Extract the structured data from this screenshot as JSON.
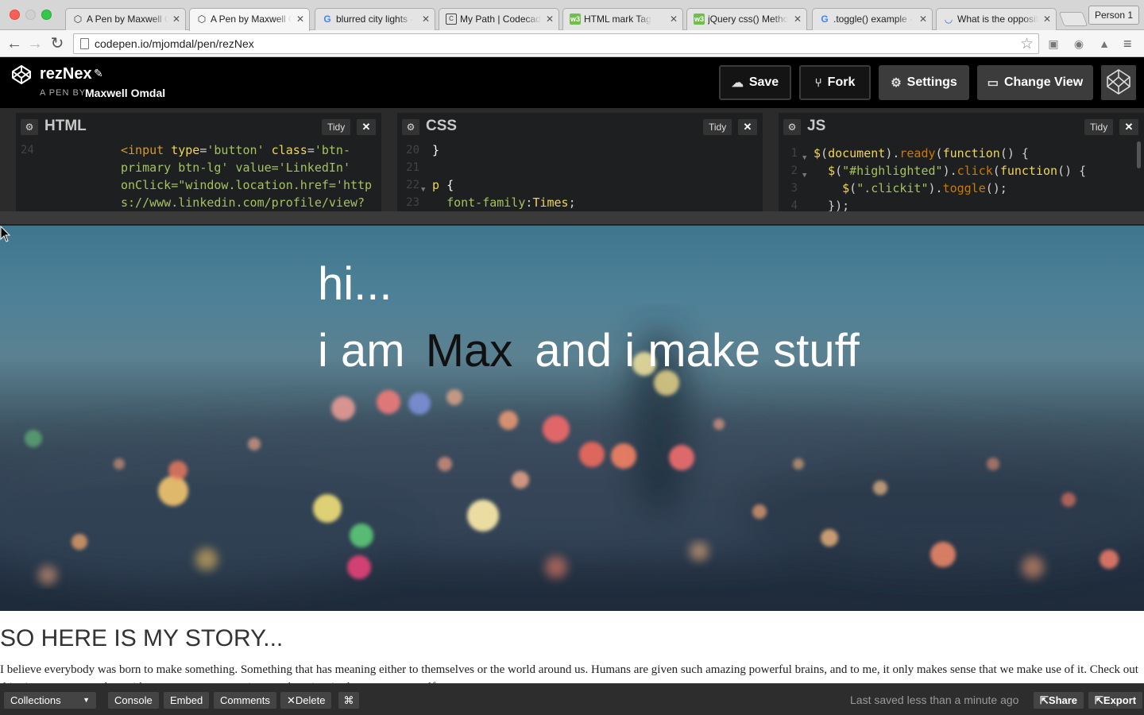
{
  "browser": {
    "tabs": [
      {
        "label": "A Pen by Maxwell O",
        "icon": "codepen-icon"
      },
      {
        "label": "A Pen by Maxwell O",
        "icon": "codepen-icon",
        "active": true
      },
      {
        "label": "blurred city lights -",
        "icon": "google-icon"
      },
      {
        "label": "My Path | Codecade",
        "icon": "codecademy-icon"
      },
      {
        "label": "HTML mark Tag",
        "icon": "w3schools-icon"
      },
      {
        "label": "jQuery css() Metho",
        "icon": "w3schools-icon"
      },
      {
        "label": ".toggle() example -",
        "icon": "google-icon"
      },
      {
        "label": "What is the opposit",
        "icon": "stackoverflow-icon"
      }
    ],
    "person": "Person 1",
    "url": "codepen.io/mjomdal/pen/rezNex"
  },
  "header": {
    "pen_title": "rezNex",
    "by_prefix": "A PEN BY",
    "author": "Maxwell Omdal",
    "buttons": {
      "save": "Save",
      "fork": "Fork",
      "settings": "Settings",
      "change_view": "Change View"
    }
  },
  "editors": {
    "tidy": "Tidy",
    "html": {
      "title": "HTML",
      "line_numbers": [
        "24"
      ],
      "lines": [
        "<input type='button' class='btn-",
        "primary btn-lg' value='LinkedIn'",
        "onClick=\"window.location.href='http",
        "s://www.linkedin.com/profile/view?"
      ]
    },
    "css": {
      "title": "CSS",
      "line_numbers": [
        "20",
        "21",
        "22",
        "23"
      ],
      "lines": [
        "}",
        "",
        "p {",
        "  font-family:Times;"
      ]
    },
    "js": {
      "title": "JS",
      "line_numbers": [
        "1",
        "2",
        "3",
        "4"
      ],
      "lines": [
        "$(document).ready(function() {",
        "  $(\"#highlighted\").click(function() {",
        "    $(\".clickit\").toggle();",
        "  });"
      ]
    }
  },
  "preview": {
    "greeting": "hi...",
    "tagline_before": "i am",
    "name": "Max",
    "tagline_after": "and i make stuff",
    "story_title": "SO HERE IS MY STORY...",
    "story_text": "I believe everybody was born to make something. Something that has meaning either to themselves or the world around us. Humans are given such amazing powerful brains, and to me, it only makes sense that we make use of it. Check out this site to stay up to date with my most recent creations, and get inspired to create yourself."
  },
  "footer": {
    "collections": "Collections",
    "console": "Console",
    "embed": "Embed",
    "comments": "Comments",
    "delete": "Delete",
    "shortcut_icon": "⌘",
    "saved_status": "Last saved less than a minute ago",
    "share": "Share",
    "export": "Export"
  },
  "colors": {
    "codepen_black": "#000000",
    "editor_bg": "#1d1f20",
    "footer_bg": "#2d2d2d",
    "button_grey": "#3c3c3c"
  }
}
